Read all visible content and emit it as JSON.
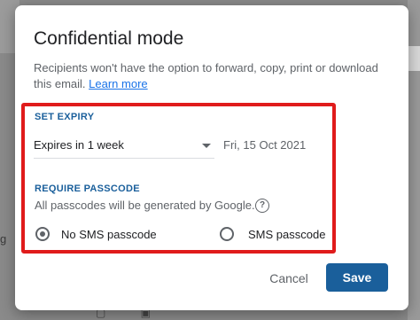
{
  "background": {
    "left_text": "g",
    "bottom_icons": "▢ ▣"
  },
  "dialog": {
    "title": "Confidential mode",
    "description": "Recipients won't have the option to forward, copy, print or download this email.",
    "learn_more": "Learn more",
    "expiry": {
      "section_label": "SET EXPIRY",
      "selected_value": "Expires in 1 week",
      "date": "Fri, 15 Oct 2021"
    },
    "passcode": {
      "section_label": "REQUIRE PASSCODE",
      "description": "All passcodes will be generated by Google.",
      "help_symbol": "?",
      "options": [
        {
          "label": "No SMS passcode",
          "checked": true
        },
        {
          "label": "SMS passcode",
          "checked": false
        }
      ]
    },
    "buttons": {
      "cancel": "Cancel",
      "save": "Save"
    }
  },
  "colors": {
    "accent": "#1a5f9b",
    "link": "#1a73e8",
    "highlight_border": "#e01b1b"
  }
}
